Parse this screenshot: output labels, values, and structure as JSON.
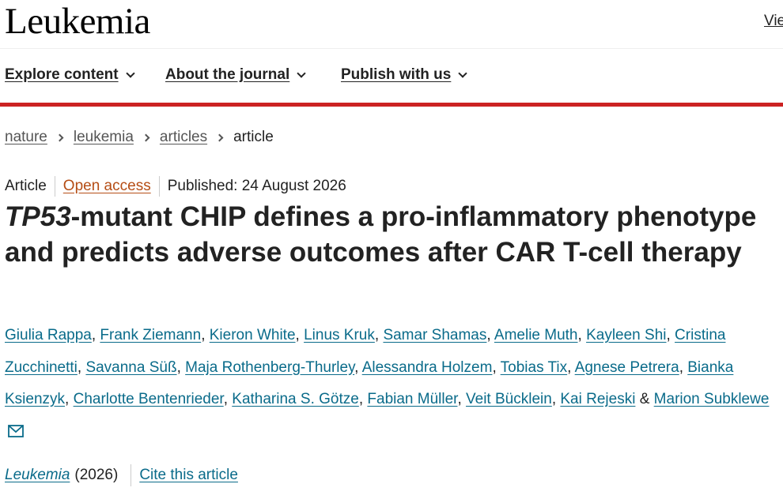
{
  "header": {
    "journal_name": "Leukemia",
    "view_link_partial": "Vie"
  },
  "nav": {
    "items": [
      {
        "label": "Explore content"
      },
      {
        "label": "About the journal"
      },
      {
        "label": "Publish with us"
      }
    ],
    "accent_color": "#cc2222"
  },
  "breadcrumb": {
    "items": [
      {
        "label": "nature"
      },
      {
        "label": "leukemia"
      },
      {
        "label": "articles"
      }
    ],
    "current": "article"
  },
  "meta": {
    "type": "Article",
    "access": "Open access",
    "published": "Published: 24 August 2026",
    "access_color": "#b54d15"
  },
  "title": {
    "gene": "TP53",
    "rest": "-mutant CHIP defines a pro-inflammatory phenotype and predicts adverse outcomes after CAR T-cell therapy"
  },
  "authors": {
    "names": [
      "Giulia Rappa",
      "Frank Ziemann",
      "Kieron White",
      "Linus Kruk",
      "Samar Shamas",
      "Amelie Muth",
      "Kayleen Shi",
      "Cristina Zucchinetti",
      "Savanna Süß",
      "Maja Rothenberg-Thurley",
      "Alessandra Holzem",
      "Tobias Tix",
      "Agnese Petrera",
      "Bianka Ksienzyk",
      "Charlotte Bentenrieder",
      "Katharina S. Götze",
      "Fabian Müller",
      "Veit Bücklein",
      "Kai Rejeski"
    ],
    "conjunction": "&",
    "last_author": "Marion Subklewe",
    "link_color": "#0a6b8a",
    "contact_icon": "mail-icon"
  },
  "citation": {
    "journal": "Leukemia",
    "year": "(2026)",
    "cite_label": "Cite this article"
  }
}
